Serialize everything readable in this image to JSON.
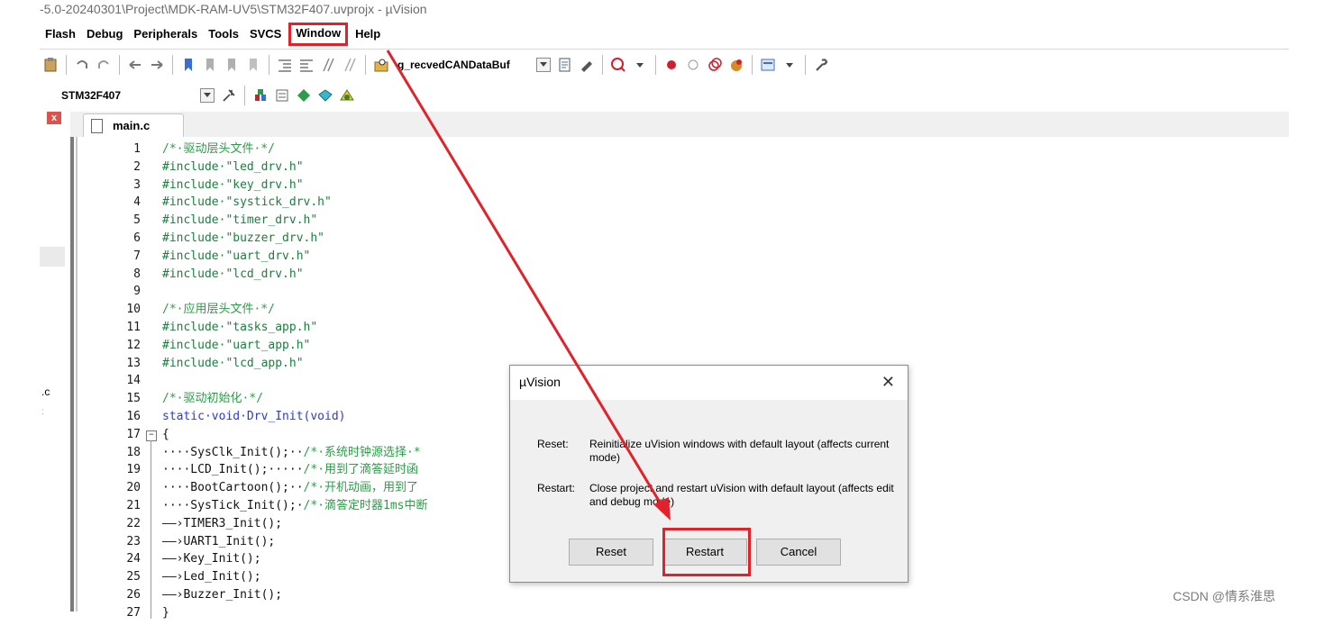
{
  "window": {
    "title": "-5.0-20240301\\Project\\MDK-RAM-UV5\\STM32F407.uvprojx - µVision"
  },
  "menu": {
    "items": [
      "Flash",
      "Debug",
      "Peripherals",
      "Tools",
      "SVCS",
      "Window",
      "Help"
    ]
  },
  "toolbar": {
    "find_value": "g_recvedCANDataBuf",
    "target_value": "STM32F407"
  },
  "editor": {
    "tab_label": "main.c",
    "lines": [
      {
        "n": "1",
        "text": "/*·驱动层头文件·*/",
        "type": "comment"
      },
      {
        "n": "2",
        "text": "#include·\"led_drv.h\"",
        "type": "pre"
      },
      {
        "n": "3",
        "text": "#include·\"key_drv.h\"",
        "type": "pre"
      },
      {
        "n": "4",
        "text": "#include·\"systick_drv.h\"",
        "type": "pre"
      },
      {
        "n": "5",
        "text": "#include·\"timer_drv.h\"",
        "type": "pre"
      },
      {
        "n": "6",
        "text": "#include·\"buzzer_drv.h\"",
        "type": "pre"
      },
      {
        "n": "7",
        "text": "#include·\"uart_drv.h\"",
        "type": "pre"
      },
      {
        "n": "8",
        "text": "#include·\"lcd_drv.h\"",
        "type": "pre"
      },
      {
        "n": "9",
        "text": "",
        "type": "plain"
      },
      {
        "n": "10",
        "text": "/*·应用层头文件·*/",
        "type": "comment"
      },
      {
        "n": "11",
        "text": "#include·\"tasks_app.h\"",
        "type": "pre"
      },
      {
        "n": "12",
        "text": "#include·\"uart_app.h\"",
        "type": "pre"
      },
      {
        "n": "13",
        "text": "#include·\"lcd_app.h\"",
        "type": "pre"
      },
      {
        "n": "14",
        "text": "",
        "type": "plain"
      },
      {
        "n": "15",
        "text": "/*·驱动初始化·*/",
        "type": "comment"
      },
      {
        "n": "16",
        "text": "static·void·Drv_Init(void)",
        "type": "kw"
      },
      {
        "n": "17",
        "text": "{",
        "type": "plain"
      },
      {
        "n": "18",
        "text": "····SysClk_Init();··/*·系统时钟源选择·*",
        "type": "mixed"
      },
      {
        "n": "19",
        "text": "····LCD_Init();·····/*·用到了滴答延时函",
        "type": "mixed"
      },
      {
        "n": "20",
        "text": "····BootCartoon();··/*·开机动画，用到了",
        "type": "mixed"
      },
      {
        "n": "21",
        "text": "····SysTick_Init();·/*·滴答定时器1ms中断",
        "type": "mixed"
      },
      {
        "n": "22",
        "text": "——›TIMER3_Init();",
        "type": "plain"
      },
      {
        "n": "23",
        "text": "——›UART1_Init();",
        "type": "plain"
      },
      {
        "n": "24",
        "text": "——›Key_Init();",
        "type": "plain"
      },
      {
        "n": "25",
        "text": "——›Led_Init();",
        "type": "plain"
      },
      {
        "n": "26",
        "text": "——›Buzzer_Init();",
        "type": "plain"
      },
      {
        "n": "27",
        "text": "}",
        "type": "plain"
      }
    ]
  },
  "sidebar": {
    "file_label": ".c",
    "dots": ":"
  },
  "dialog": {
    "title": "µVision",
    "close": "✕",
    "reset_key": "Reset:",
    "reset_desc": "Reinitialize uVision windows with default layout (affects current mode)",
    "restart_key": "Restart:",
    "restart_desc": "Close project and restart uVision with default layout (affects edit and debug mode)",
    "buttons": {
      "reset": "Reset",
      "restart": "Restart",
      "cancel": "Cancel"
    }
  },
  "watermark": "CSDN @情系淮思",
  "colors": {
    "highlight": "#e0222b",
    "comment": "#2e9b4a",
    "keyword": "#2b3bd6"
  }
}
